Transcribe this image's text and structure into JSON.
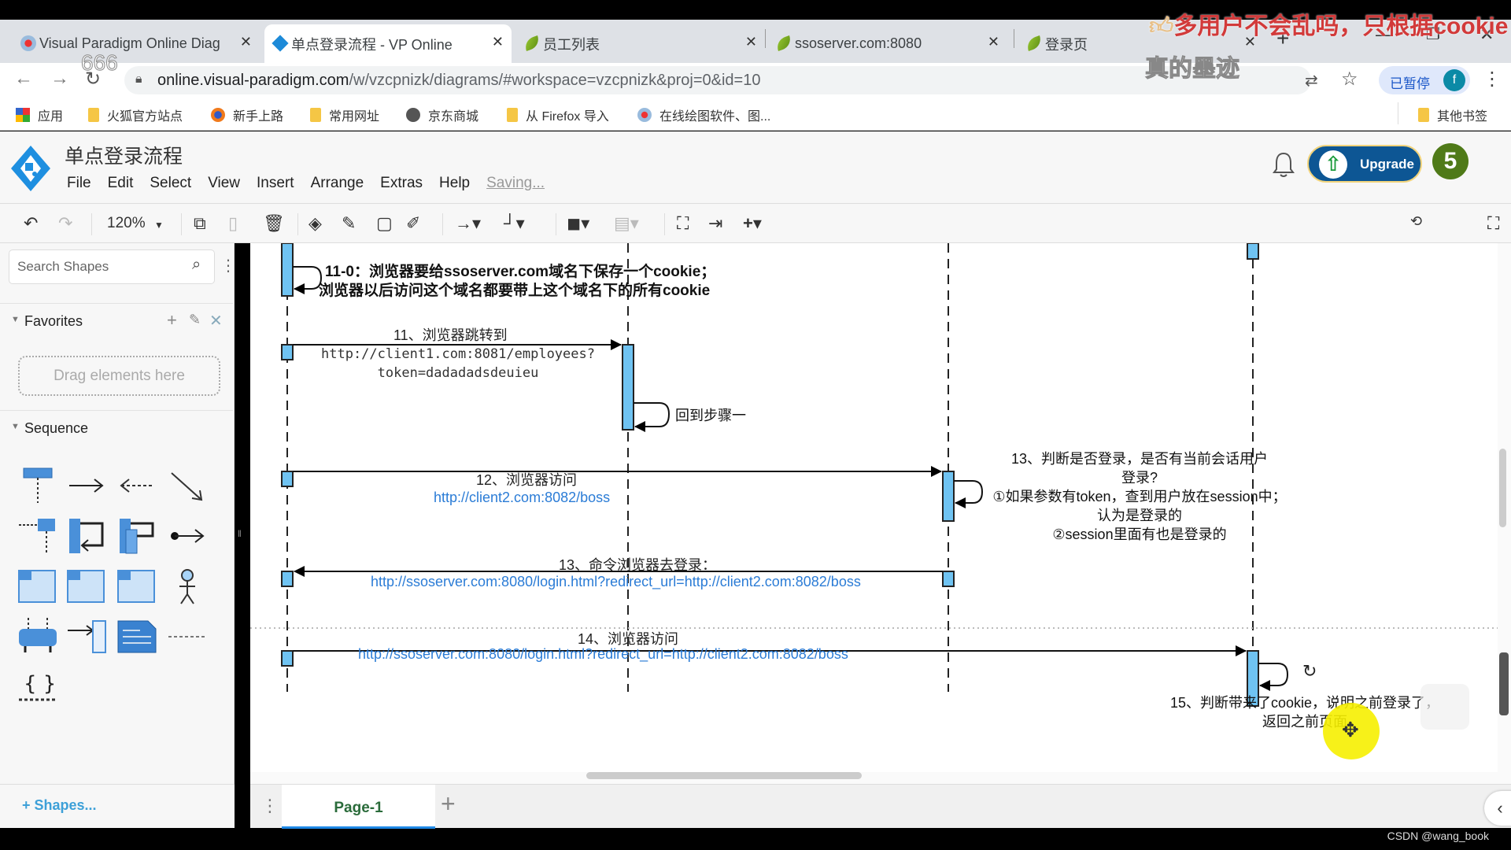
{
  "browser": {
    "tabs": [
      {
        "title": "Visual Paradigm Online Diag",
        "icon": "vp-gear-icon",
        "active": false
      },
      {
        "title": "单点登录流程 - VP Online",
        "icon": "vp-diamond-icon",
        "active": true
      },
      {
        "title": "员工列表",
        "icon": "spring-leaf-icon",
        "active": false
      },
      {
        "title": "ssoserver.com:8080",
        "icon": "spring-leaf-icon",
        "active": false
      },
      {
        "title": "登录页",
        "icon": "spring-leaf-icon",
        "active": false
      }
    ],
    "close_glyph": "✕",
    "new_tab_glyph": "+",
    "url_host": "online.visual-paradigm.com",
    "url_path": "/w/vzcpnizk/diagrams/#workspace=vzcpnizk&proj=0&id=10",
    "profile_label": "已暂停",
    "profile_initial": "f",
    "bookmarks": [
      {
        "label": "应用",
        "icon": "apps-grid-icon"
      },
      {
        "label": "火狐官方站点",
        "icon": "folder-icon"
      },
      {
        "label": "新手上路",
        "icon": "firefox-icon"
      },
      {
        "label": "常用网址",
        "icon": "folder-icon"
      },
      {
        "label": "京东商城",
        "icon": "globe-icon"
      },
      {
        "label": "从 Firefox 导入",
        "icon": "folder-icon"
      },
      {
        "label": "在线绘图软件、图...",
        "icon": "vp-gear-icon"
      }
    ],
    "other_bookmarks": "其他书签"
  },
  "video_overlay": {
    "danmaku_red": "多用户不会乱吗，只根据cookie",
    "danmaku_white": "真的墨迹",
    "danmaku_666": "666",
    "watermark": "CSDN @wang_book"
  },
  "app": {
    "title": "单点登录流程",
    "menu": [
      "File",
      "Edit",
      "Select",
      "View",
      "Insert",
      "Arrange",
      "Extras",
      "Help"
    ],
    "saving": "Saving...",
    "upgrade_label": "Upgrade",
    "avatar_text": "5",
    "zoom": "120%"
  },
  "sidebar": {
    "search_placeholder": "Search Shapes",
    "favorites_label": "Favorites",
    "drag_hint": "Drag elements here",
    "sequence_label": "Sequence",
    "shapes_link": "+ Shapes..."
  },
  "pages": {
    "tabs": [
      "Page-1"
    ],
    "add_glyph": "+"
  },
  "diagram": {
    "notes": {
      "step11_0_line1": "11-0：浏览器要给ssoserver.com域名下保存一个cookie；",
      "step11_0_line2": "浏览器以后访问这个域名都要带上这个域名下的所有cookie",
      "step11_title": "11、浏览器跳转到",
      "step11_url1": "http://client1.com:8081/employees?",
      "step11_url2": "token=dadadadsdeuieu",
      "back_step1": "回到步骤一",
      "step12_title": "12、浏览器访问",
      "step12_url": "http://client2.com:8082/boss",
      "step13a_l1": "13、判断是否登录，是否有当前会话用户",
      "step13a_l2": "登录?",
      "step13a_l3": "①如果参数有token，查到用户放在session中；",
      "step13a_l4": "认为是登录的",
      "step13a_l5": "②session里面有也是登录的",
      "step13b_title": "13、命令浏览器去登录：",
      "step13b_url": "http://ssoserver.com:8080/login.html?redirect_url=http://client2.com:8082/boss",
      "step14_title": "14、浏览器访问",
      "step14_url": "http://ssoserver.com:8080/login.html?redirect_url=http://client2.com:8082/boss",
      "step15_l1": "15、判断带来了cookie，说明之前登录了，",
      "step15_l2": "返回之前页面"
    }
  }
}
